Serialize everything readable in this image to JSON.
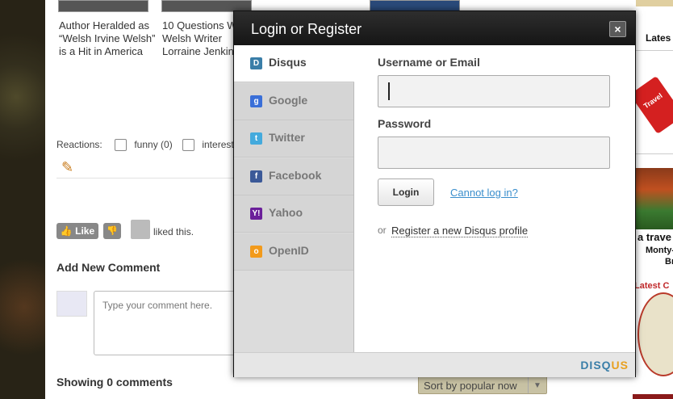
{
  "articles": [
    {
      "title": "Author Heralded as “Welsh Irvine Welsh” is a Hit in America"
    },
    {
      "title": "10 Questions W Welsh Writer Lorraine Jenkin"
    }
  ],
  "reactions": {
    "label": "Reactions:",
    "items": [
      "funny (0)",
      "interest"
    ]
  },
  "like": {
    "like_label": "Like",
    "liked_text": "liked this."
  },
  "comments": {
    "add_title": "Add New Comment",
    "placeholder": "Type your comment here.",
    "showing": "Showing 0 comments",
    "sort_label": "Sort by popular now"
  },
  "sidebar": {
    "latest": "Lates",
    "ad_tag": "Travel",
    "ad2_line1": "a trave",
    "ad2_line2": "Monty-",
    "ad2_line3": "Br",
    "latest2": "Latest C"
  },
  "modal": {
    "title": "Login or Register",
    "close": "×",
    "tabs": [
      {
        "label": "Disqus",
        "icon": "disqus-icon",
        "color": "#3a7ea8",
        "glyph": "D"
      },
      {
        "label": "Google",
        "icon": "google-icon",
        "color": "#3a6fd8",
        "glyph": "g"
      },
      {
        "label": "Twitter",
        "icon": "twitter-icon",
        "color": "#44aadd",
        "glyph": "t"
      },
      {
        "label": "Facebook",
        "icon": "facebook-icon",
        "color": "#3b5998",
        "glyph": "f"
      },
      {
        "label": "Yahoo",
        "icon": "yahoo-icon",
        "color": "#6b1f9a",
        "glyph": "Y!"
      },
      {
        "label": "OpenID",
        "icon": "openid-icon",
        "color": "#f29a1b",
        "glyph": "o"
      }
    ],
    "username_label": "Username or Email",
    "password_label": "Password",
    "login_button": "Login",
    "cant_login": "Cannot log in?",
    "or_text": "or",
    "register_link": "Register a new Disqus profile",
    "footer_logo_a": "DISQ",
    "footer_logo_b": "US"
  }
}
